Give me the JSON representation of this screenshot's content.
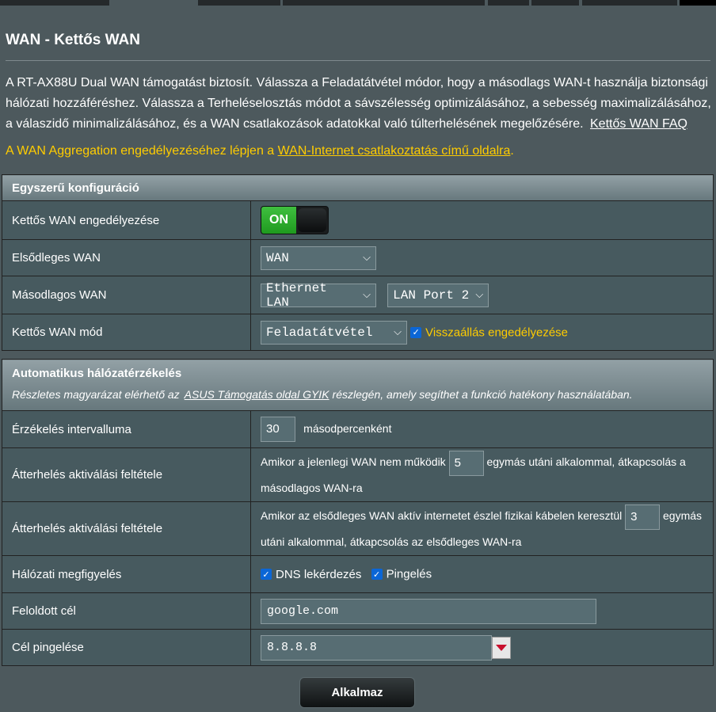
{
  "page": {
    "title": "WAN - Kettős WAN",
    "description": "A RT-AX88U Dual WAN támogatást biztosít. Válassza a Feladatátvétel módor, hogy a másodlags WAN-t használja biztonsági hálózati hozzáféréshez. Válassza a Terheléselosztás módot a sávszélesség optimizálásához, a sebesség maximalizálásához, a válaszidő minimalizálásához, és a WAN csatlakozások adatokkal való túlterhelésének megelőzésére.",
    "faq_link": "Kettős WAN FAQ",
    "notice_prefix": "A WAN Aggregation engedélyezéséhez lépjen a ",
    "notice_link": "WAN-Internet csatlakoztatás című oldalra",
    "notice_suffix": "."
  },
  "basic": {
    "header": "Egyszerű konfiguráció",
    "enable_label": "Kettős WAN engedélyezése",
    "toggle_on": "ON",
    "primary_label": "Elsődleges WAN",
    "primary_value": "WAN",
    "secondary_label": "Másodlagos WAN",
    "secondary_value": "Ethernet LAN",
    "secondary_port": "LAN Port 2",
    "mode_label": "Kettős WAN mód",
    "mode_value": "Feladatátvétel",
    "fallback_label": "Visszaállás engedélyezése"
  },
  "detect": {
    "header": "Automatikus hálózatérzékelés",
    "sub_prefix": "Részletes magyarázat elérhető az",
    "sub_link": "ASUS Támogatás oldal GYIK",
    "sub_suffix": "részlegén, amely segíthet a funkció hatékony használatában.",
    "interval_label": "Érzékelés intervalluma",
    "interval_value": "30",
    "interval_unit": "másodpercenként",
    "failover_label": "Átterhelés aktiválási feltétele",
    "failover_text1": "Amikor a jelenlegi WAN nem működik",
    "failover_value": "5",
    "failover_text2": "egymás utáni alkalommal, átkapcsolás a másodlagos WAN-ra",
    "failback_label": "Átterhelés aktiválási feltétele",
    "failback_text1": "Amikor az elsődleges WAN aktív internetet észlel fizikai kábelen keresztül",
    "failback_value": "3",
    "failback_text2": "egymás utáni alkalommal, átkapcsolás az elsődleges WAN-ra",
    "monitor_label": "Hálózati megfigyelés",
    "dns_label": "DNS lekérdezés",
    "ping_label": "Pingelés",
    "resolve_label": "Feloldott cél",
    "resolve_value": "google.com",
    "ping_target_label": "Cél pingelése",
    "ping_target_value": "8.8.8.8"
  },
  "apply_label": "Alkalmaz",
  "icons": {
    "chevron": "chevron-down-icon",
    "check": "check-icon",
    "dropdown": "dropdown-arrow-icon"
  },
  "colors": {
    "accent": "#ffcc00",
    "toggle_on": "#2eaa2e",
    "checkbox": "#0b66d6"
  }
}
